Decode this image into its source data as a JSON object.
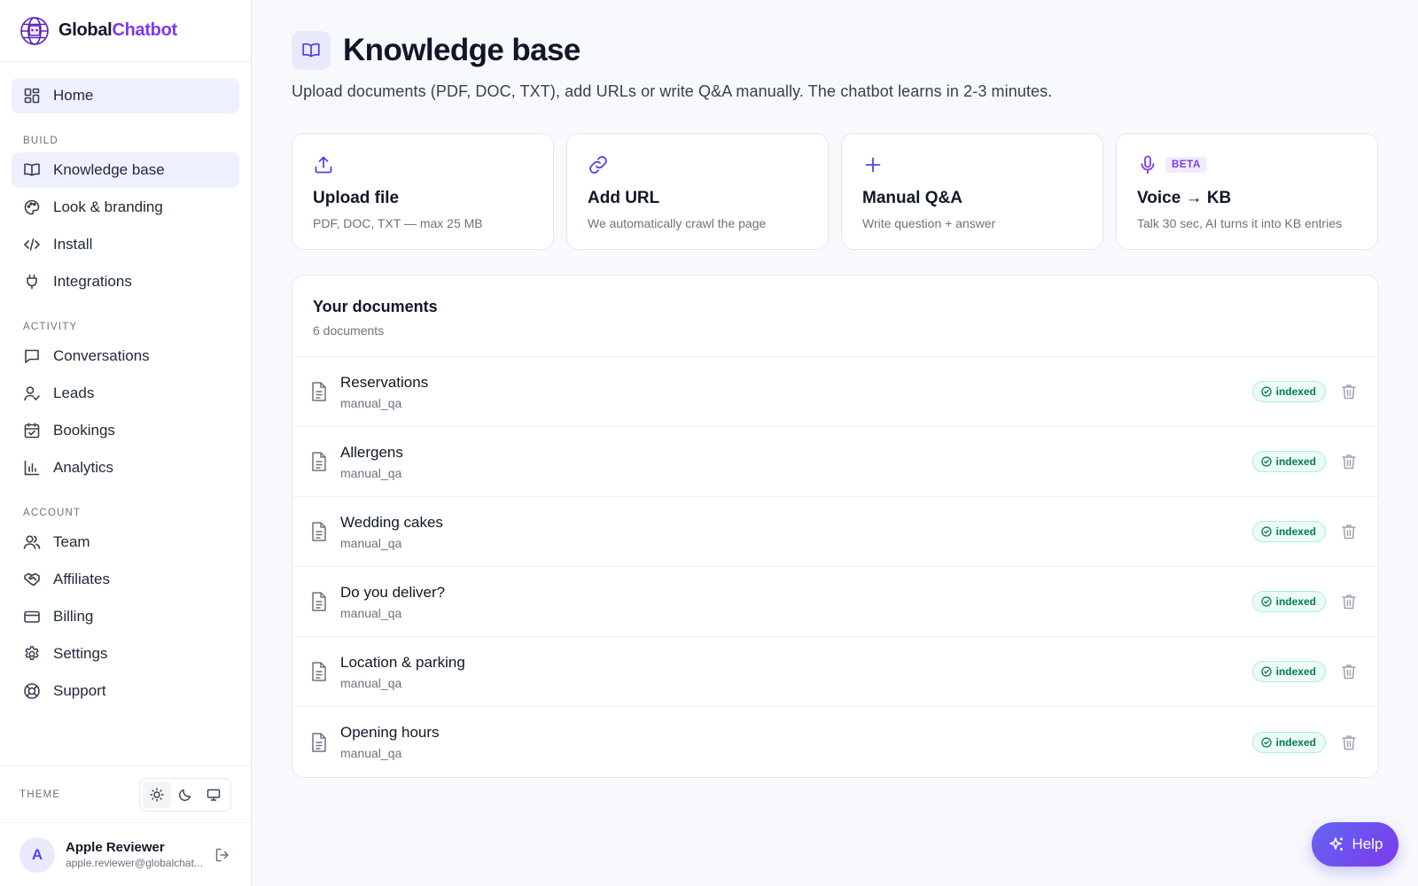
{
  "brand": {
    "name_part1": "Global",
    "name_part2": "Chatbot",
    "accent_color": "#7c3aed"
  },
  "sidebar": {
    "home": {
      "label": "Home",
      "icon": "grid-icon"
    },
    "sections": [
      {
        "label": "BUILD",
        "items": [
          {
            "label": "Knowledge base",
            "icon": "book-icon",
            "active": true
          },
          {
            "label": "Look & branding",
            "icon": "palette-icon"
          },
          {
            "label": "Install",
            "icon": "code-icon"
          },
          {
            "label": "Integrations",
            "icon": "plug-icon"
          }
        ]
      },
      {
        "label": "ACTIVITY",
        "items": [
          {
            "label": "Conversations",
            "icon": "chat-icon"
          },
          {
            "label": "Leads",
            "icon": "user-check-icon"
          },
          {
            "label": "Bookings",
            "icon": "calendar-check-icon"
          },
          {
            "label": "Analytics",
            "icon": "bar-chart-icon"
          }
        ]
      },
      {
        "label": "ACCOUNT",
        "items": [
          {
            "label": "Team",
            "icon": "users-icon"
          },
          {
            "label": "Affiliates",
            "icon": "handshake-icon"
          },
          {
            "label": "Billing",
            "icon": "credit-card-icon"
          },
          {
            "label": "Settings",
            "icon": "gear-icon"
          },
          {
            "label": "Support",
            "icon": "lifebuoy-icon"
          }
        ]
      }
    ],
    "theme": {
      "label": "THEME",
      "options": [
        "sun-icon",
        "moon-icon",
        "monitor-icon"
      ],
      "selected": "sun-icon"
    },
    "user": {
      "initial": "A",
      "name": "Apple Reviewer",
      "email": "apple.reviewer@globalchat..."
    }
  },
  "main": {
    "title": "Knowledge base",
    "subtitle": "Upload documents (PDF, DOC, TXT), add URLs or write Q&A manually. The chatbot learns in 2-3 minutes.",
    "cards": [
      {
        "icon": "upload-icon",
        "title": "Upload file",
        "desc": "PDF, DOC, TXT — max 25 MB"
      },
      {
        "icon": "link-icon",
        "title": "Add URL",
        "desc": "We automatically crawl the page"
      },
      {
        "icon": "plus-icon",
        "title": "Manual Q&A",
        "desc": "Write question + answer"
      },
      {
        "icon": "mic-icon",
        "title": "Voice → KB",
        "desc": "Talk 30 sec, AI turns it into KB entries",
        "badge": "BETA"
      }
    ],
    "documents": {
      "title": "Your documents",
      "count": "6 documents",
      "items": [
        {
          "name": "Reservations",
          "source": "manual_qa",
          "status": "indexed"
        },
        {
          "name": "Allergens",
          "source": "manual_qa",
          "status": "indexed"
        },
        {
          "name": "Wedding cakes",
          "source": "manual_qa",
          "status": "indexed"
        },
        {
          "name": "Do you deliver?",
          "source": "manual_qa",
          "status": "indexed"
        },
        {
          "name": "Location & parking",
          "source": "manual_qa",
          "status": "indexed"
        },
        {
          "name": "Opening hours",
          "source": "manual_qa",
          "status": "indexed"
        }
      ]
    }
  },
  "help": {
    "label": "Help",
    "icon": "sparkles-icon"
  },
  "colors": {
    "primary": "#4f46e5",
    "success": "#047857",
    "success_bg": "#ecfdf5"
  }
}
